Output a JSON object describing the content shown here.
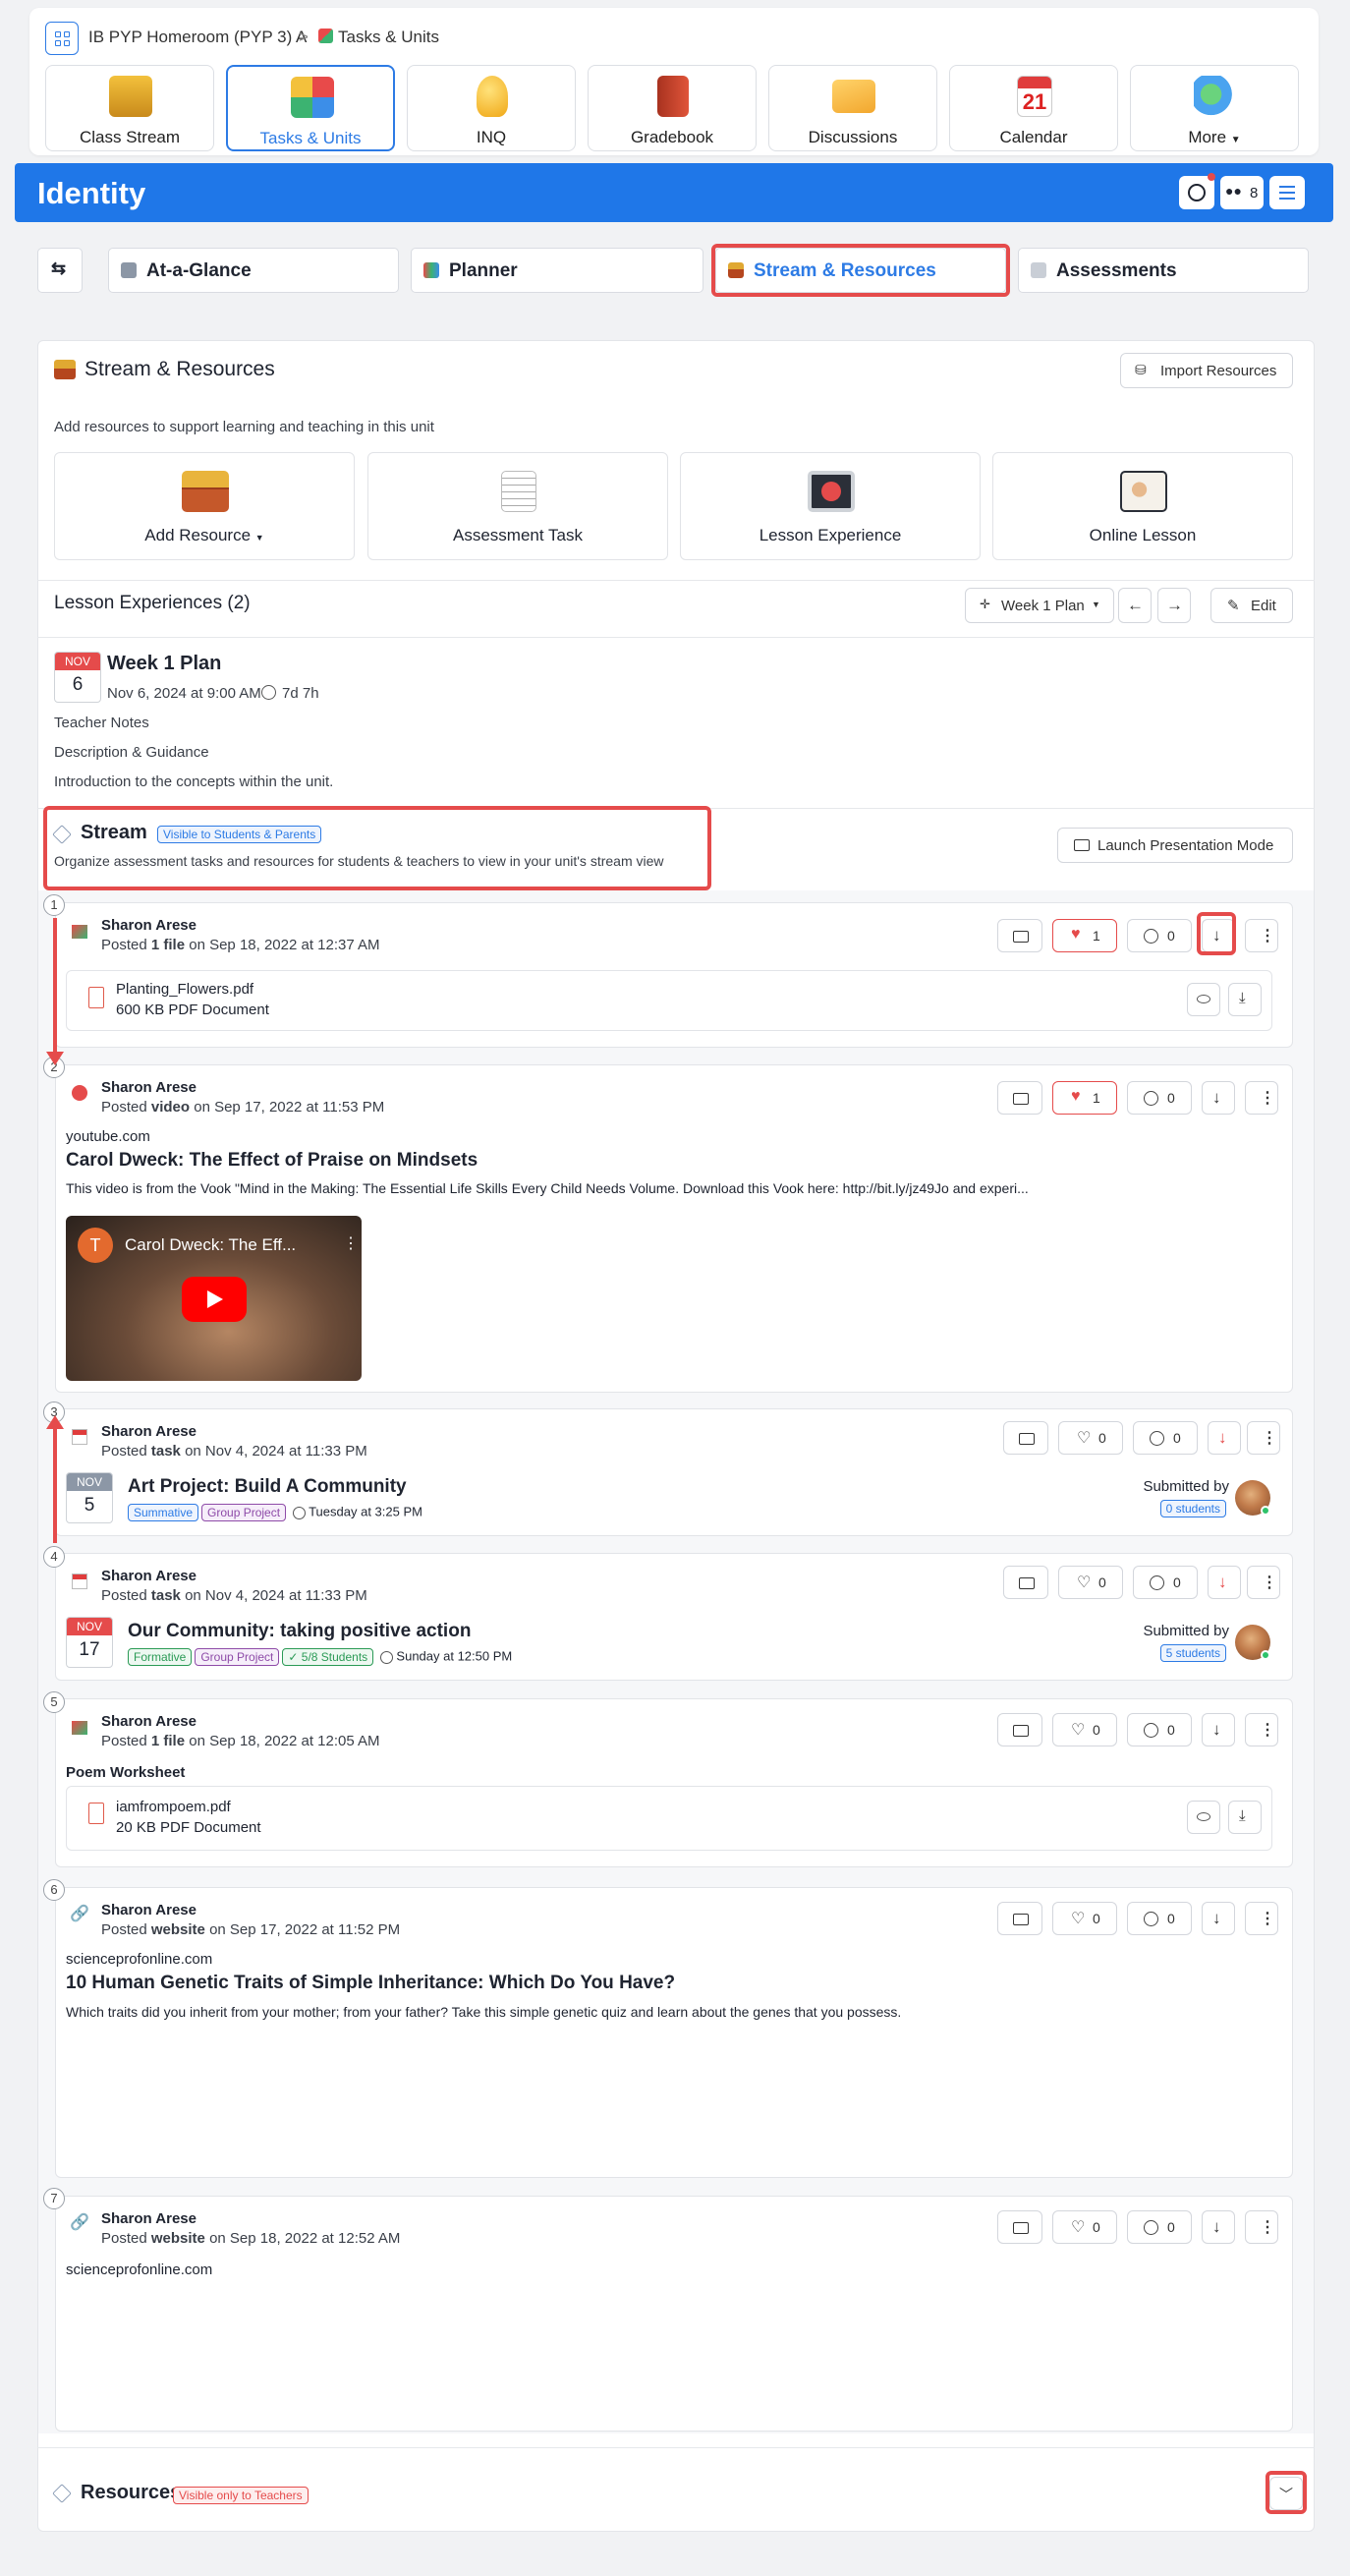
{
  "breadcrumb": {
    "class_name": "IB PYP Homeroom (PYP 3) A",
    "separator": ">",
    "current": "Tasks & Units"
  },
  "nav": [
    {
      "label": "Class Stream",
      "icon": "class-stream-icon"
    },
    {
      "label": "Tasks & Units",
      "icon": "puzzle-icon"
    },
    {
      "label": "INQ",
      "icon": "lightbulb-icon"
    },
    {
      "label": "Gradebook",
      "icon": "gradebook-icon"
    },
    {
      "label": "Discussions",
      "icon": "envelope-icon"
    },
    {
      "label": "Calendar",
      "icon": "calendar-icon",
      "day": "21"
    },
    {
      "label": "More",
      "icon": "more-icon"
    }
  ],
  "unit": {
    "title": "Identity",
    "members_count": "8"
  },
  "subtabs": [
    {
      "label": "At-a-Glance"
    },
    {
      "label": "Planner"
    },
    {
      "label": "Stream & Resources"
    },
    {
      "label": "Assessments"
    }
  ],
  "stream_resources": {
    "title": "Stream & Resources",
    "import_label": "Import Resources",
    "description": "Add resources to support learning and teaching in this unit",
    "cards": [
      {
        "label": "Add Resource",
        "icon": "treasure-chest-icon"
      },
      {
        "label": "Assessment Task",
        "icon": "checklist-icon"
      },
      {
        "label": "Lesson Experience",
        "icon": "monitor-play-icon"
      },
      {
        "label": "Online Lesson",
        "icon": "online-lesson-icon"
      }
    ]
  },
  "lessons": {
    "title": "Lesson Experiences (2)",
    "plan_select": "Week 1 Plan",
    "edit_label": "Edit",
    "plan": {
      "month": "NOV",
      "day": "6",
      "title": "Week 1 Plan",
      "datetime": "Nov 6, 2024 at 9:00 AM",
      "duration": "7d 7h",
      "notes": [
        "Teacher Notes",
        "Description & Guidance",
        "Introduction to the concepts within the unit."
      ]
    }
  },
  "stream": {
    "title": "Stream",
    "visibility": "Visible to Students & Parents",
    "description": "Organize assessment tasks and resources for students & teachers to view in your unit's stream view",
    "launch_label": "Launch Presentation Mode"
  },
  "posts": [
    {
      "num": "1",
      "author": "Sharon Arese",
      "prefix": "Posted ",
      "kind": "1 file",
      "suffix": " on Sep 18, 2022 at 12:37 AM",
      "likes": "1",
      "comments": "0",
      "file": {
        "name": "Planting_Flowers.pdf",
        "meta": "600 KB PDF Document"
      }
    },
    {
      "num": "2",
      "author": "Sharon Arese",
      "prefix": "Posted ",
      "kind": "video",
      "suffix": " on Sep 17, 2022 at 11:53 PM",
      "likes": "1",
      "comments": "0",
      "source": "youtube.com",
      "title": "Carol Dweck: The Effect of Praise on Mindsets",
      "desc": "This video is from the Vook \"Mind in the Making: The Essential Life Skills Every Child Needs Volume. Download this Vook here: http://bit.ly/jz49Jo and experi...",
      "thumb_title": "Carol Dweck: The Eff...",
      "thumb_avatar": "T"
    },
    {
      "num": "3",
      "author": "Sharon Arese",
      "prefix": "Posted ",
      "kind": "task",
      "suffix": " on Nov 4, 2024 at 11:33 PM",
      "likes": "0",
      "comments": "0",
      "month": "NOV",
      "day": "5",
      "title": "Art Project: Build A Community",
      "tags": [
        "Summative",
        "Group Project"
      ],
      "due": "Tuesday at 3:25 PM",
      "submitted_label": "Submitted by",
      "submitted": "0 students"
    },
    {
      "num": "4",
      "author": "Sharon Arese",
      "prefix": "Posted ",
      "kind": "task",
      "suffix": " on Nov 4, 2024 at 11:33 PM",
      "likes": "0",
      "comments": "0",
      "month": "NOV",
      "day": "17",
      "title": "Our Community: taking positive action",
      "tags": [
        "Formative",
        "Group Project",
        "5/8 Students"
      ],
      "due": "Sunday at 12:50 PM",
      "submitted_label": "Submitted by",
      "submitted": "5 students"
    },
    {
      "num": "5",
      "author": "Sharon Arese",
      "prefix": "Posted ",
      "kind": "1 file",
      "suffix": " on Sep 18, 2022 at 12:05 AM",
      "likes": "0",
      "comments": "0",
      "caption": "Poem Worksheet",
      "file": {
        "name": "iamfrompoem.pdf",
        "meta": "20 KB PDF Document"
      }
    },
    {
      "num": "6",
      "author": "Sharon Arese",
      "prefix": "Posted ",
      "kind": "website",
      "suffix": " on Sep 17, 2022 at 11:52 PM",
      "likes": "0",
      "comments": "0",
      "source": "scienceprofonline.com",
      "title": "10 Human Genetic Traits of Simple Inheritance: Which Do You Have?",
      "desc": "Which traits did you inherit from your mother; from your father? Take this simple genetic quiz and learn about the genes that you possess."
    },
    {
      "num": "7",
      "author": "Sharon Arese",
      "prefix": "Posted ",
      "kind": "website",
      "suffix": " on Sep 18, 2022 at 12:52 AM",
      "likes": "0",
      "comments": "0",
      "source": "scienceprofonline.com"
    }
  ],
  "resources": {
    "title": "Resources",
    "visibility": "Visible only to Teachers"
  },
  "colors": {
    "brand": "#1f77e8",
    "highlight": "#e54b4b",
    "active": "#2d7be5"
  }
}
